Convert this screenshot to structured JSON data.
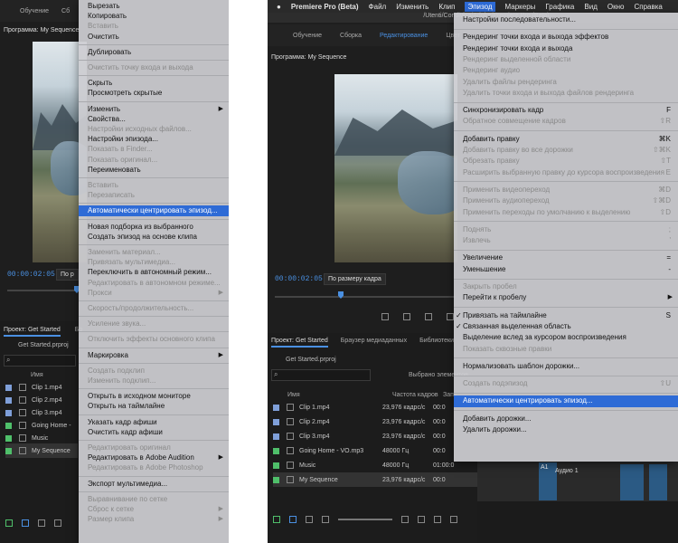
{
  "left": {
    "topbar_items": [
      "Обучение",
      "Сб"
    ],
    "program_title": "Программа: My Sequence",
    "timecode": "00:00:02:05",
    "fit_label": "По р",
    "project_tabs": [
      "Проект: Get Started",
      "Бр"
    ],
    "project_file": "Get Started.prproj",
    "column_name": "Имя",
    "clips": [
      {
        "name": "Clip 1.mp4",
        "color": "#7f9fd9"
      },
      {
        "name": "Clip 2.mp4",
        "color": "#7f9fd9"
      },
      {
        "name": "Clip 3.mp4",
        "color": "#7f9fd9"
      },
      {
        "name": "Going Home -",
        "color": "#4fbf6a"
      },
      {
        "name": "Music",
        "color": "#4fbf6a"
      },
      {
        "name": "My Sequence",
        "color": "#4fbf6a"
      }
    ],
    "menu": [
      {
        "label": "Вырезать",
        "state": "normal"
      },
      {
        "label": "Копировать",
        "state": "normal"
      },
      {
        "label": "Вставить",
        "state": "disabled"
      },
      {
        "label": "Очистить",
        "state": "normal"
      },
      {
        "sep": true
      },
      {
        "label": "Дублировать",
        "state": "normal"
      },
      {
        "sep": true
      },
      {
        "label": "Очистить точку входа и выхода",
        "state": "disabled"
      },
      {
        "sep": true
      },
      {
        "label": "Скрыть",
        "state": "normal"
      },
      {
        "label": "Просмотреть скрытые",
        "state": "normal"
      },
      {
        "sep": true
      },
      {
        "label": "Изменить",
        "state": "normal",
        "submenu": true
      },
      {
        "label": "Свойства...",
        "state": "normal"
      },
      {
        "label": "Настройки исходных файлов...",
        "state": "disabled"
      },
      {
        "label": "Настройки эпизода...",
        "state": "normal"
      },
      {
        "label": "Показать в Finder...",
        "state": "disabled"
      },
      {
        "label": "Показать оригинал...",
        "state": "disabled"
      },
      {
        "label": "Переименовать",
        "state": "normal"
      },
      {
        "sep": true
      },
      {
        "label": "Вставить",
        "state": "disabled"
      },
      {
        "label": "Перезаписать",
        "state": "disabled"
      },
      {
        "sep": true
      },
      {
        "label": "Автоматически центрировать эпизод...",
        "state": "selected"
      },
      {
        "sep": true
      },
      {
        "label": "Новая подборка из выбранного",
        "state": "normal"
      },
      {
        "label": "Создать эпизод на основе клипа",
        "state": "normal"
      },
      {
        "sep": true
      },
      {
        "label": "Заменить материал...",
        "state": "disabled"
      },
      {
        "label": "Привязать мультимедиа...",
        "state": "disabled"
      },
      {
        "label": "Переключить в автономный режим...",
        "state": "normal"
      },
      {
        "label": "Редактировать в автономном режиме...",
        "state": "disabled"
      },
      {
        "label": "Прокси",
        "state": "disabled",
        "submenu": true
      },
      {
        "sep": true
      },
      {
        "label": "Скорость/продолжительность...",
        "state": "disabled"
      },
      {
        "sep": true
      },
      {
        "label": "Усиление звука...",
        "state": "disabled"
      },
      {
        "sep": true
      },
      {
        "label": "Отключить эффекты основного клипа",
        "state": "disabled"
      },
      {
        "sep": true
      },
      {
        "label": "Маркировка",
        "state": "normal",
        "submenu": true
      },
      {
        "sep": true
      },
      {
        "label": "Создать подклип",
        "state": "disabled"
      },
      {
        "label": "Изменить подклип...",
        "state": "disabled"
      },
      {
        "sep": true
      },
      {
        "label": "Открыть в исходном мониторе",
        "state": "normal"
      },
      {
        "label": "Открыть на таймлайне",
        "state": "normal"
      },
      {
        "sep": true
      },
      {
        "label": "Указать кадр афиши",
        "state": "normal"
      },
      {
        "label": "Очистить кадр афиши",
        "state": "normal"
      },
      {
        "sep": true
      },
      {
        "label": "Редактировать оригинал",
        "state": "disabled"
      },
      {
        "label": "Редактировать в Adobe Audition",
        "state": "normal",
        "submenu": true
      },
      {
        "label": "Редактировать в Adobe Photoshop",
        "state": "disabled"
      },
      {
        "sep": true
      },
      {
        "label": "Экспорт мультимедиа...",
        "state": "normal"
      },
      {
        "sep": true
      },
      {
        "label": "Выравнивание по сетке",
        "state": "disabled"
      },
      {
        "label": "Сброс к сетке",
        "state": "disabled",
        "submenu": true
      },
      {
        "label": "Размер клипа",
        "state": "disabled",
        "submenu": true
      }
    ]
  },
  "right": {
    "macbar": [
      "Premiere Pro (Beta)",
      "Файл",
      "Изменить",
      "Клип",
      "Эпизод",
      "Маркеры",
      "Графика",
      "Вид",
      "Окно",
      "Справка"
    ],
    "macbar_active": "Эпизод",
    "path": "/Utenti/Condivisa/Adobe/Premiere Pro (Beta)",
    "workspace_tabs": [
      "Обучение",
      "Сборка",
      "Редактирование",
      "Цвет"
    ],
    "workspace_active": "Редактирование",
    "program_title": "Программа: My Sequence",
    "timecode": "00:00:02:05",
    "fit_label": "По размеру кадра",
    "project_tabs": [
      "Проект: Get Started",
      "Браузер медиаданных",
      "Библиотеки"
    ],
    "project_file": "Get Started.prproj",
    "selected_label": "Выбрано элементов",
    "columns": [
      "Имя",
      "Частота кадров",
      "Запу"
    ],
    "clips": [
      {
        "name": "Clip 1.mp4",
        "rate": "23,976 кадрс/с",
        "start": "00:0",
        "color": "#7f9fd9"
      },
      {
        "name": "Clip 2.mp4",
        "rate": "23,976 кадрс/с",
        "start": "00:0",
        "color": "#7f9fd9"
      },
      {
        "name": "Clip 3.mp4",
        "rate": "23,976 кадрс/с",
        "start": "00:0",
        "color": "#7f9fd9"
      },
      {
        "name": "Going Home - VO.mp3",
        "rate": "48000 Гц",
        "start": "00:0",
        "color": "#4fbf6a"
      },
      {
        "name": "Music",
        "rate": "48000 Гц",
        "start": "01:00:0",
        "color": "#4fbf6a"
      },
      {
        "name": "My Sequence",
        "rate": "23,976 кадрс/с",
        "start": "00:0",
        "color": "#4fbf6a"
      }
    ],
    "track_label": "Аудио 1",
    "track_id": "A1",
    "menu": [
      {
        "label": "Настройки последовательности...",
        "state": "normal"
      },
      {
        "sep": true
      },
      {
        "label": "Рендеринг точки входа и выхода эффектов",
        "state": "normal"
      },
      {
        "label": "Рендеринг точки входа и выхода",
        "state": "normal"
      },
      {
        "label": "Рендеринг выделенной области",
        "state": "disabled"
      },
      {
        "label": "Рендеринг аудио",
        "state": "disabled"
      },
      {
        "label": "Удалить файлы рендеринга",
        "state": "disabled"
      },
      {
        "label": "Удалить точки входа и выхода файлов рендеринга",
        "state": "disabled"
      },
      {
        "sep": true
      },
      {
        "label": "Синхронизировать кадр",
        "state": "normal",
        "shortcut": "F"
      },
      {
        "label": "Обратное совмещение кадров",
        "state": "disabled",
        "shortcut": "⇧R"
      },
      {
        "sep": true
      },
      {
        "label": "Добавить правку",
        "state": "normal",
        "shortcut": "⌘K"
      },
      {
        "label": "Добавить правку во все дорожки",
        "state": "disabled",
        "shortcut": "⇧⌘K"
      },
      {
        "label": "Обрезать правку",
        "state": "disabled",
        "shortcut": "⇧T"
      },
      {
        "label": "Расширить выбранную правку до курсора воспроизведения",
        "state": "disabled",
        "shortcut": "E"
      },
      {
        "sep": true
      },
      {
        "label": "Применить видеопереход",
        "state": "disabled",
        "shortcut": "⌘D"
      },
      {
        "label": "Применить аудиопереход",
        "state": "disabled",
        "shortcut": "⇧⌘D"
      },
      {
        "label": "Применить переходы по умолчанию к выделению",
        "state": "disabled",
        "shortcut": "⇧D"
      },
      {
        "sep": true
      },
      {
        "label": "Поднять",
        "state": "disabled",
        "shortcut": ";"
      },
      {
        "label": "Извлечь",
        "state": "disabled",
        "shortcut": "'"
      },
      {
        "sep": true
      },
      {
        "label": "Увеличение",
        "state": "normal",
        "shortcut": "="
      },
      {
        "label": "Уменьшение",
        "state": "normal",
        "shortcut": "-"
      },
      {
        "sep": true
      },
      {
        "label": "Закрыть пробел",
        "state": "disabled"
      },
      {
        "label": "Перейти к пробелу",
        "state": "normal",
        "submenu": true
      },
      {
        "sep": true
      },
      {
        "label": "Привязать на таймлайне",
        "state": "normal",
        "shortcut": "S",
        "checked": true
      },
      {
        "label": "Связанная выделенная область",
        "state": "normal",
        "checked": true
      },
      {
        "label": "Выделение вслед за курсором воспроизведения",
        "state": "normal"
      },
      {
        "label": "Показать сквозные правки",
        "state": "disabled"
      },
      {
        "sep": true
      },
      {
        "label": "Нормализовать шаблон дорожки...",
        "state": "normal"
      },
      {
        "sep": true
      },
      {
        "label": "Создать подэпизод",
        "state": "disabled",
        "shortcut": "⇧U"
      },
      {
        "sep": true
      },
      {
        "label": "Автоматически центрировать эпизод...",
        "state": "selected"
      },
      {
        "sep": true
      },
      {
        "label": "Добавить дорожки...",
        "state": "normal"
      },
      {
        "label": "Удалить дорожки...",
        "state": "normal"
      }
    ]
  }
}
